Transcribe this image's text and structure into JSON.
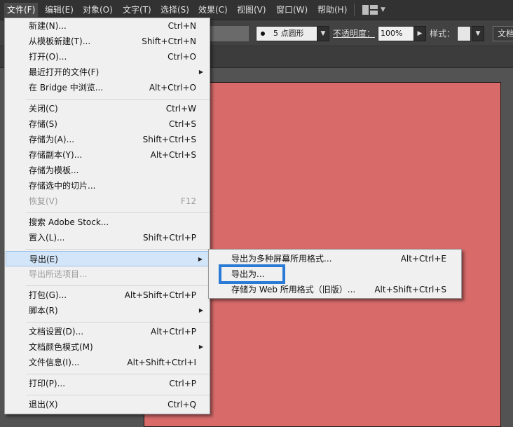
{
  "menubar": {
    "items": [
      "文件(F)",
      "编辑(E)",
      "对象(O)",
      "文字(T)",
      "选择(S)",
      "效果(C)",
      "视图(V)",
      "窗口(W)",
      "帮助(H)"
    ],
    "layout_icon": "workspace-layout-icon"
  },
  "options": {
    "brush": "5 点圆形",
    "opacity_label": "不透明度：",
    "opacity_value": "100%",
    "style_label": "样式：",
    "doc_button": "文档"
  },
  "file_menu": {
    "items": [
      {
        "label": "新建(N)...",
        "shortcut": "Ctrl+N"
      },
      {
        "label": "从模板新建(T)...",
        "shortcut": "Shift+Ctrl+N"
      },
      {
        "label": "打开(O)...",
        "shortcut": "Ctrl+O"
      },
      {
        "label": "最近打开的文件(F)",
        "shortcut": ""
      },
      {
        "label": "在 Bridge 中浏览...",
        "shortcut": "Alt+Ctrl+O"
      },
      {
        "label": "关闭(C)",
        "shortcut": "Ctrl+W"
      },
      {
        "label": "存储(S)",
        "shortcut": "Ctrl+S"
      },
      {
        "label": "存储为(A)...",
        "shortcut": "Shift+Ctrl+S"
      },
      {
        "label": "存储副本(Y)...",
        "shortcut": "Alt+Ctrl+S"
      },
      {
        "label": "存储为模板...",
        "shortcut": ""
      },
      {
        "label": "存储选中的切片...",
        "shortcut": ""
      },
      {
        "label": "恢复(V)",
        "shortcut": "F12"
      },
      {
        "label": "搜索 Adobe Stock...",
        "shortcut": ""
      },
      {
        "label": "置入(L)...",
        "shortcut": "Shift+Ctrl+P"
      },
      {
        "label": "导出(E)",
        "shortcut": ""
      },
      {
        "label": "导出所选项目...",
        "shortcut": ""
      },
      {
        "label": "打包(G)...",
        "shortcut": "Alt+Shift+Ctrl+P"
      },
      {
        "label": "脚本(R)",
        "shortcut": ""
      },
      {
        "label": "文档设置(D)...",
        "shortcut": "Alt+Ctrl+P"
      },
      {
        "label": "文档颜色模式(M)",
        "shortcut": ""
      },
      {
        "label": "文件信息(I)...",
        "shortcut": "Alt+Shift+Ctrl+I"
      },
      {
        "label": "打印(P)...",
        "shortcut": "Ctrl+P"
      },
      {
        "label": "退出(X)",
        "shortcut": "Ctrl+Q"
      }
    ]
  },
  "export_submenu": {
    "items": [
      {
        "label": "导出为多种屏幕所用格式...",
        "shortcut": "Alt+Ctrl+E"
      },
      {
        "label": "导出为...",
        "shortcut": ""
      },
      {
        "label": "存储为 Web 所用格式（旧版）...",
        "shortcut": "Alt+Shift+Ctrl+S"
      }
    ]
  },
  "colors": {
    "artboard": "#d86a6a",
    "highlight_box": "#2b7bd6",
    "menu_bg": "#f0f0f0"
  }
}
